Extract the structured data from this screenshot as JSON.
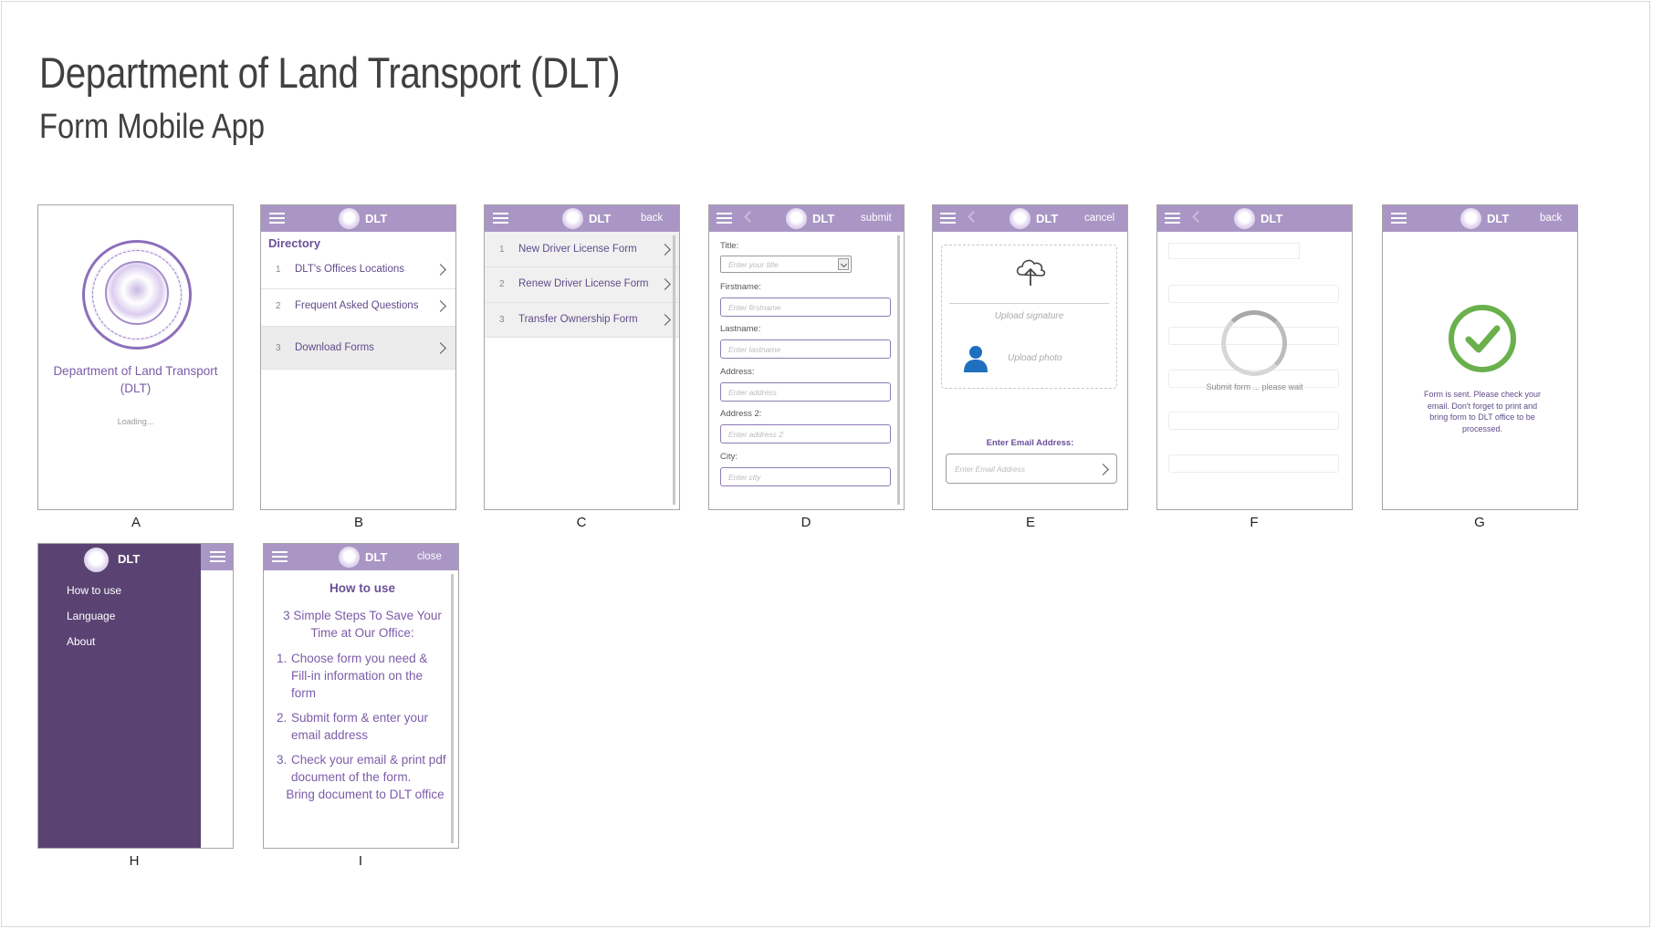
{
  "slide": {
    "title": "Department of Land Transport (DLT)",
    "subtitle": "Form Mobile App"
  },
  "app_name": "DLT",
  "colors": {
    "header": "#a996c4",
    "accent_text": "#7b5ca8",
    "menu_bg": "#5a4372",
    "success": "#6ab04c"
  },
  "screens": {
    "a": {
      "caption": "A",
      "name": "Department of Land Transport (DLT)",
      "loading": "Loading..."
    },
    "b": {
      "caption": "B",
      "heading": "Directory",
      "items": [
        {
          "num": "1",
          "label": "DLT's Offices Locations"
        },
        {
          "num": "2",
          "label": "Frequent Asked Questions"
        },
        {
          "num": "3",
          "label": "Download Forms"
        }
      ]
    },
    "c": {
      "caption": "C",
      "action": "back",
      "items": [
        {
          "num": "1",
          "label": "New Driver License Form"
        },
        {
          "num": "2",
          "label": "Renew Driver License Form"
        },
        {
          "num": "3",
          "label": "Transfer Ownership Form"
        }
      ]
    },
    "d": {
      "caption": "D",
      "action": "submit",
      "fields": [
        {
          "label": "Title:",
          "placeholder": "Enter your title"
        },
        {
          "label": "Firstname:",
          "placeholder": "Enter firstname"
        },
        {
          "label": "Lastname:",
          "placeholder": "Enter lastname"
        },
        {
          "label": "Address:",
          "placeholder": "Enter address"
        },
        {
          "label": "Address 2:",
          "placeholder": "Enter address 2"
        },
        {
          "label": "City:",
          "placeholder": "Enter city"
        }
      ]
    },
    "e": {
      "caption": "E",
      "action": "cancel",
      "upload_signature": "Upload signature",
      "upload_photo": "Upload photo",
      "email_label": "Enter Email Address:",
      "email_placeholder": "Enter Email Address"
    },
    "f": {
      "caption": "F",
      "status": "Submit form ... please wait"
    },
    "g": {
      "caption": "G",
      "action": "back",
      "message": "Form is sent. Please check your email. Don't forget to print and bring form to DLT office to be processed."
    },
    "h": {
      "caption": "H",
      "menu": [
        "How to use",
        "Language",
        "About"
      ]
    },
    "i": {
      "caption": "I",
      "action": "close",
      "heading": "How to use",
      "intro": "3 Simple Steps To Save Your Time at Our Office:",
      "steps": [
        {
          "n": "1.",
          "text": "Choose form you need & Fill-in information on the form"
        },
        {
          "n": "2.",
          "text": "Submit form & enter your email address"
        },
        {
          "n": "3.",
          "text": "Check your email & print pdf document of the form."
        }
      ],
      "footer": "Bring document to DLT office"
    }
  }
}
